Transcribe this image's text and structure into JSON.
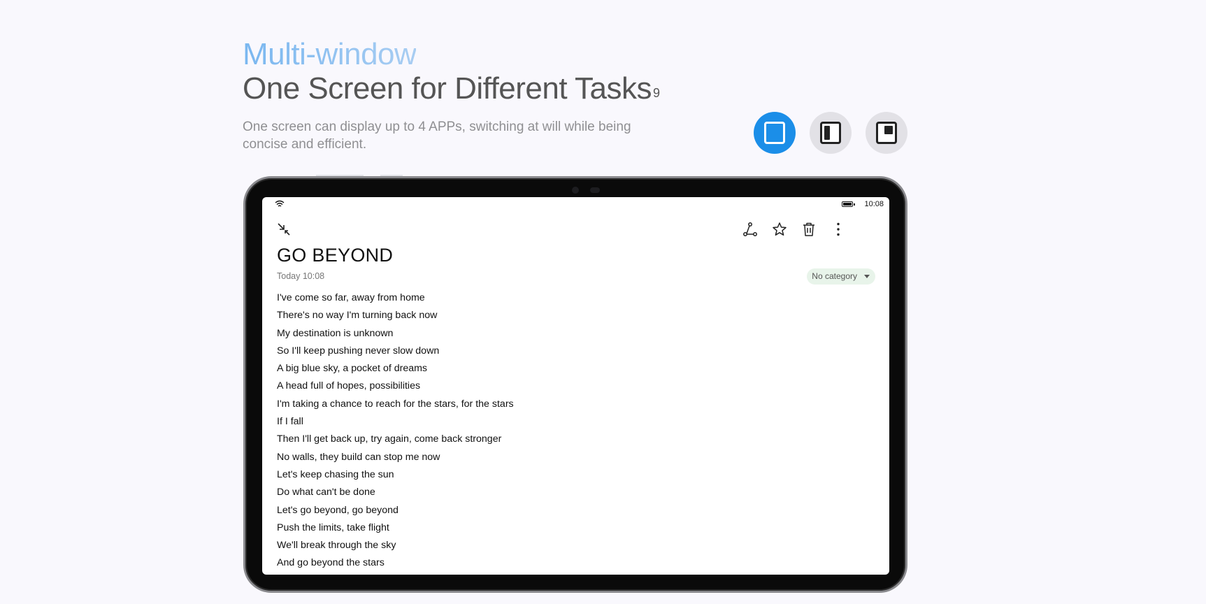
{
  "hero": {
    "eyebrow": "Multi-window",
    "headline": "One Screen for Different Tasks",
    "footnote": "9",
    "description": "One screen can display up to 4 APPs, switching at will while being concise and efficient."
  },
  "layout_switcher": [
    {
      "name": "full-screen-mode",
      "active": true
    },
    {
      "name": "split-screen-mode",
      "active": false
    },
    {
      "name": "floating-window-mode",
      "active": false
    }
  ],
  "device": {
    "status_bar": {
      "time": "10:08"
    },
    "toolbar": {
      "left_icon": "collapse-icon",
      "right_icons": [
        "share-icon",
        "star-icon",
        "trash-icon",
        "more-icon"
      ]
    },
    "note": {
      "title": "GO BEYOND",
      "date": "Today 10:08",
      "category": "No category",
      "lines": [
        "I've come so far, away from home",
        "There's no way I'm turning back now",
        "My destination is unknown",
        "So I'll keep pushing never slow down",
        "A big blue sky, a pocket of dreams",
        "A head full of hopes, possibilities",
        "I'm taking a chance to reach for the stars, for the stars",
        "If I fall",
        "Then I'll get back up, try again, come back stronger",
        "No walls, they build can stop me now",
        "Let's keep chasing the sun",
        "Do what can't be done",
        "Let's go beyond, go beyond",
        "Push the limits, take flight",
        "We'll break through the sky",
        "And go beyond the stars"
      ]
    }
  }
}
